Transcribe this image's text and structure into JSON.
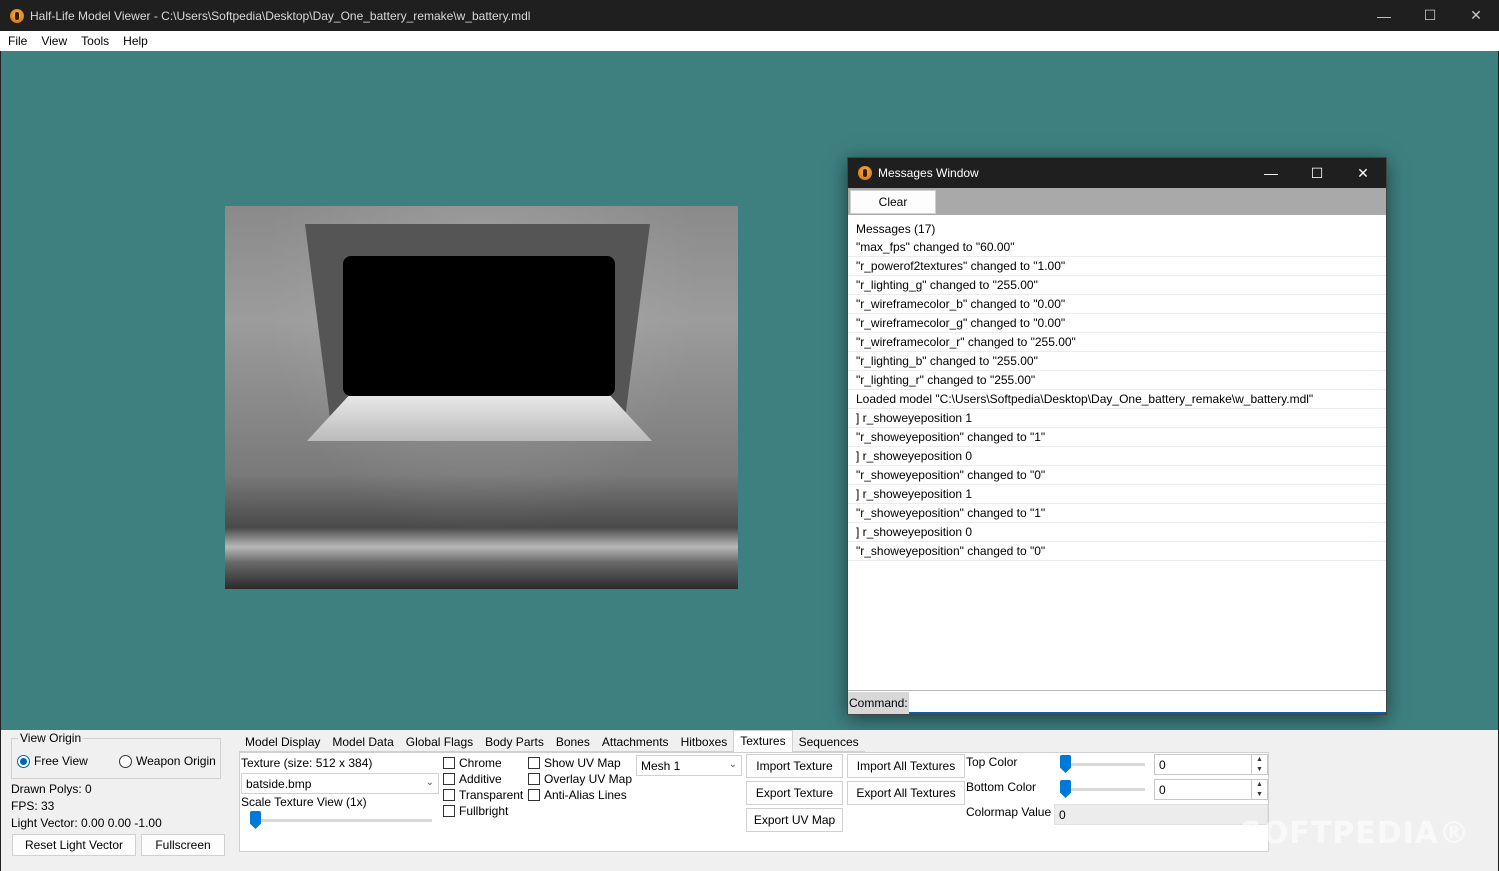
{
  "window": {
    "title": "Half-Life Model Viewer - C:\\Users\\Softpedia\\Desktop\\Day_One_battery_remake\\w_battery.mdl"
  },
  "controls": {
    "minimize": "—",
    "maximize": "☐",
    "close": "✕"
  },
  "menu": [
    "File",
    "View",
    "Tools",
    "Help"
  ],
  "colors": {
    "viewport_bg": "#3e8080",
    "accent": "#0078d7"
  },
  "messages_window": {
    "title": "Messages Window",
    "clear_label": "Clear",
    "header": "Messages (17)",
    "items": [
      "\"max_fps\" changed to \"60.00\"",
      "\"r_powerof2textures\" changed to \"1.00\"",
      "\"r_lighting_g\" changed to \"255.00\"",
      "\"r_wireframecolor_b\" changed to \"0.00\"",
      "\"r_wireframecolor_g\" changed to \"0.00\"",
      "\"r_wireframecolor_r\" changed to \"255.00\"",
      "\"r_lighting_b\" changed to \"255.00\"",
      "\"r_lighting_r\" changed to \"255.00\"",
      "Loaded model \"C:\\Users\\Softpedia\\Desktop\\Day_One_battery_remake\\w_battery.mdl\"",
      "] r_showeyeposition 1",
      "\"r_showeyeposition\" changed to \"1\"",
      "] r_showeyeposition 0",
      "\"r_showeyeposition\" changed to \"0\"",
      "] r_showeyeposition 1",
      "\"r_showeyeposition\" changed to \"1\"",
      "] r_showeyeposition 0",
      "\"r_showeyeposition\" changed to \"0\""
    ],
    "command_label": "Command:",
    "command_value": ""
  },
  "view_origin": {
    "legend": "View Origin",
    "free_view": "Free View",
    "weapon_origin": "Weapon Origin",
    "selected": "Free View"
  },
  "stats": {
    "drawn_polys": "Drawn Polys: 0",
    "fps": "FPS: 33",
    "light_vector": "Light Vector: 0.00 0.00 -1.00"
  },
  "buttons": {
    "reset_light": "Reset Light Vector",
    "fullscreen": "Fullscreen",
    "import_texture": "Import Texture",
    "import_all": "Import All Textures",
    "export_texture": "Export Texture",
    "export_all": "Export All Textures",
    "export_uv": "Export UV Map"
  },
  "tabs": [
    "Model Display",
    "Model Data",
    "Global Flags",
    "Body Parts",
    "Bones",
    "Attachments",
    "Hitboxes",
    "Textures",
    "Sequences"
  ],
  "active_tab": "Textures",
  "textures": {
    "size_label": "Texture (size: 512 x 384)",
    "texture_name": "batside.bmp",
    "scale_label": "Scale Texture View (1x)",
    "scale_value": 0.0,
    "mesh": "Mesh 1",
    "flags": [
      "Chrome",
      "Additive",
      "Transparent",
      "Fullbright"
    ],
    "uv_options": [
      "Show UV Map",
      "Overlay UV Map",
      "Anti-Alias Lines"
    ],
    "top_color_label": "Top Color",
    "top_color_value": "0",
    "bottom_color_label": "Bottom Color",
    "bottom_color_value": "0",
    "colormap_label": "Colormap Value",
    "colormap_value": "0"
  },
  "watermark": "SOFTPEDIA®"
}
